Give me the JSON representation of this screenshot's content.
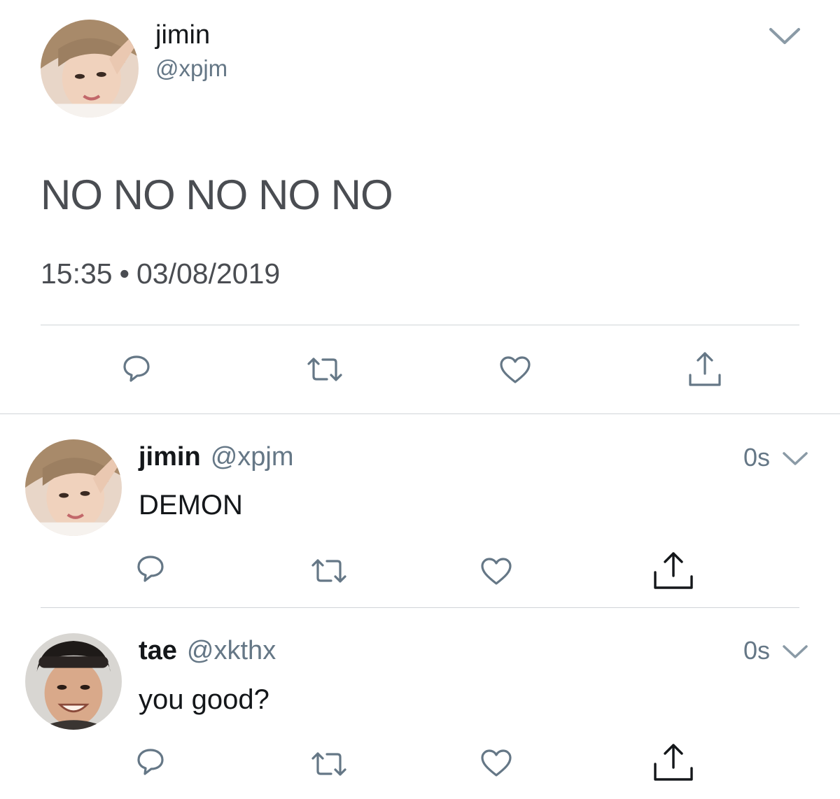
{
  "main_tweet": {
    "display_name": "jimin",
    "handle": "@xpjm",
    "text": "NO NO NO NO NO",
    "time": "15:35",
    "separator": "•",
    "date": "03/08/2019",
    "avatar_icon": "avatar-photo",
    "actions": [
      "reply-icon",
      "retweet-icon",
      "like-icon",
      "share-icon"
    ]
  },
  "replies": [
    {
      "display_name": "jimin",
      "handle": "@xpjm",
      "time": "0s",
      "text": "DEMON"
    },
    {
      "display_name": "tae",
      "handle": "@xkthx",
      "time": "0s",
      "text": "you good?"
    }
  ],
  "colors": {
    "icon": "#657786",
    "divider": "#d0d4d8",
    "text": "#14171a",
    "muted": "#657786"
  }
}
